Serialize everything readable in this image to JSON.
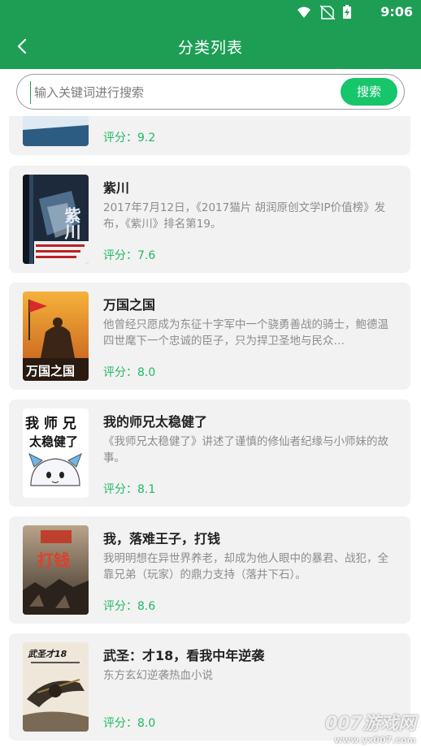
{
  "status_bar": {
    "time": "9:06",
    "icons": [
      "wifi-icon",
      "no-sim-icon",
      "battery-charging-icon"
    ]
  },
  "app_bar": {
    "title": "分类列表",
    "back_icon": "chevron-left-icon"
  },
  "search": {
    "placeholder": "输入关键词进行搜索",
    "button_label": "搜索",
    "value": ""
  },
  "colors": {
    "primary": "#1e9e55",
    "accent": "#17c56a",
    "rating": "#1fba62"
  },
  "books": [
    {
      "name": "",
      "desc": "",
      "rating": "评分：9.2"
    },
    {
      "name": "紫川",
      "desc": "2017年7月12日，《2017猫片 胡润原创文学IP价值榜》发布，《紫川》排名第19。",
      "rating": "评分：7.6",
      "cover_text": "紫川"
    },
    {
      "name": "万国之国",
      "desc": "他曾经只愿成为东征十字军中一个骁勇善战的骑士，鲍德温四世麾下一个忠诚的臣子，只为捍卫圣地与民众…",
      "rating": "评分：8.0",
      "cover_text": "万国之国"
    },
    {
      "name": "我的师兄太稳健了",
      "desc": "《我师兄太稳健了》讲述了谨慎的修仙者纪缘与小师妹的故事。",
      "rating": "评分：8.1",
      "cover_text_1": "我 师 兄",
      "cover_text_2": "太稳健了"
    },
    {
      "name": "我，落难王子，打钱",
      "desc": "我明明想在异世界养老，却成为他人眼中的暴君、战犯，全靠兄弟（玩家）的鼎力支持（落井下石）。",
      "rating": "评分：8.6",
      "cover_text": "打钱"
    },
    {
      "name": "武圣：才18，看我中年逆袭",
      "desc": "东方玄幻逆袭热血小说",
      "rating": "评分：8.0",
      "cover_text": "武圣才18"
    }
  ],
  "watermark": {
    "line1": "007游戏网",
    "line2": "www.yx007.com"
  }
}
